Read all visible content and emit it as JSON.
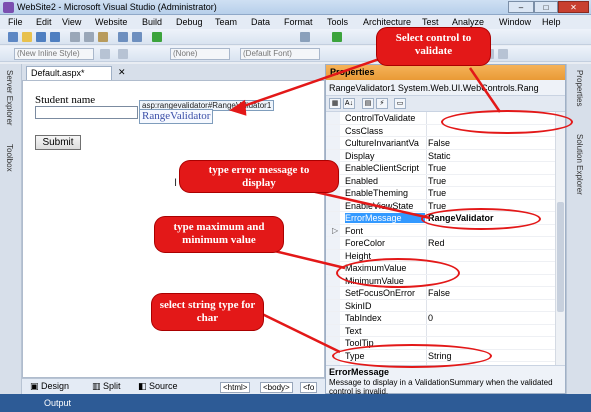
{
  "window": {
    "title": "WebSite2 - Microsoft Visual Studio (Administrator)",
    "buttons": [
      "–",
      "□",
      "✕"
    ]
  },
  "menu": [
    "File",
    "Edit",
    "View",
    "Website",
    "Build",
    "Debug",
    "Team",
    "Data",
    "Format",
    "Tools",
    "Architecture",
    "Test",
    "Analyze",
    "Window",
    "Help"
  ],
  "toolbar2": {
    "style_combo": "(New Inline Style)",
    "block_combo": "(None)",
    "font_combo": "(Default Font)"
  },
  "left_tabs": [
    "Server Explorer",
    "Toolbox"
  ],
  "right_tabs": [
    "Properties",
    "Solution Explorer"
  ],
  "document": {
    "tab_label": "Default.aspx*",
    "tab_close": "✕",
    "student_label": "Student name",
    "smart_tag": "asp:rangevalidator#RangeValidator1",
    "validator_text": "RangeValidator",
    "submit_label": "Submit"
  },
  "viewbar": {
    "design": "Design",
    "split": "Split",
    "source": "Source",
    "crumbs": [
      "<html>",
      "<body>",
      "<fo"
    ]
  },
  "output_label": "Output",
  "properties": {
    "title": "Properties",
    "selected_object": "RangeValidator1 System.Web.UI.WebControls.Rang",
    "rows": [
      {
        "name": "ControlToValidate",
        "value": ""
      },
      {
        "name": "CssClass",
        "value": ""
      },
      {
        "name": "CultureInvariantVa",
        "value": "False"
      },
      {
        "name": "Display",
        "value": "Static"
      },
      {
        "name": "EnableClientScript",
        "value": "True"
      },
      {
        "name": "Enabled",
        "value": "True"
      },
      {
        "name": "EnableTheming",
        "value": "True"
      },
      {
        "name": "EnableViewState",
        "value": "True"
      },
      {
        "name": "ErrorMessage",
        "value": "RangeValidator",
        "selected": true
      },
      {
        "name": "Font",
        "value": "",
        "expandable": true
      },
      {
        "name": "ForeColor",
        "value": "Red"
      },
      {
        "name": "Height",
        "value": ""
      },
      {
        "name": "MaximumValue",
        "value": ""
      },
      {
        "name": "MinimumValue",
        "value": ""
      },
      {
        "name": "SetFocusOnError",
        "value": "False"
      },
      {
        "name": "SkinID",
        "value": ""
      },
      {
        "name": "TabIndex",
        "value": "0"
      },
      {
        "name": "Text",
        "value": ""
      },
      {
        "name": "ToolTip",
        "value": ""
      },
      {
        "name": "Type",
        "value": "String"
      }
    ],
    "desc_title": "ErrorMessage",
    "desc_text": "Message to display in a ValidationSummary when the validated control is invalid."
  },
  "annotations": {
    "select_control": "Select control to validate",
    "error_message": "type error message to display",
    "max_min": "type maximum and minimum value",
    "string_type": "select string type for char"
  },
  "colors": {
    "annotation_red": "#e31818",
    "selection_blue": "#3399ff",
    "properties_header": "#f0a545"
  }
}
